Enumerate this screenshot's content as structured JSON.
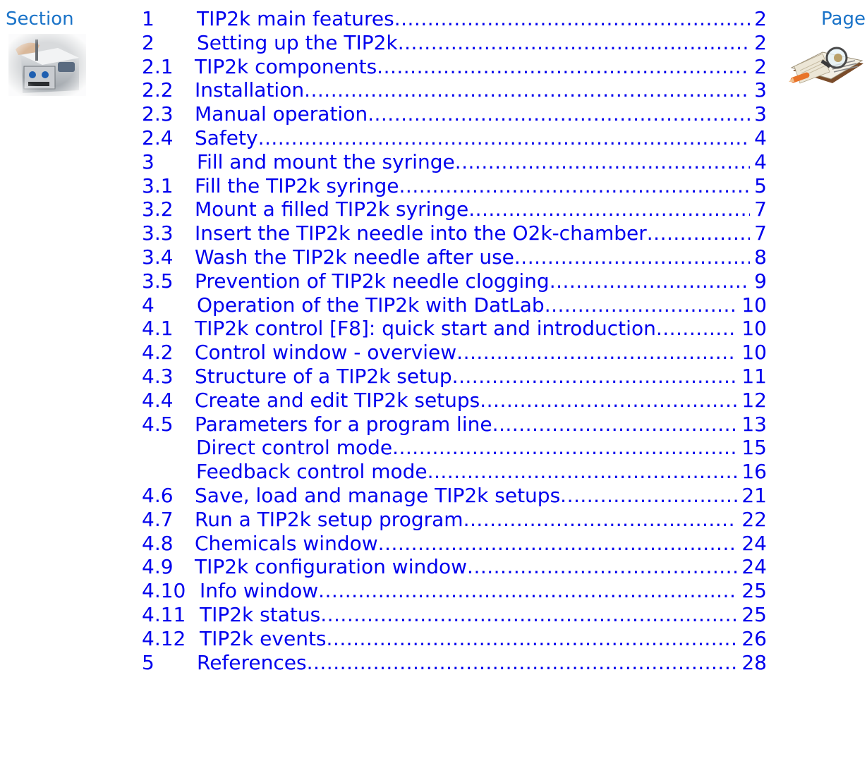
{
  "header": {
    "section_label": "Section",
    "page_label": "Page"
  },
  "icons": {
    "device": "tip2k-device-photo",
    "book": "book-magnifier-icon"
  },
  "toc": [
    {
      "num": "1",
      "title": "TIP2k main features",
      "page": "2"
    },
    {
      "num": "2",
      "title": "Setting up the TIP2k",
      "page": "2"
    },
    {
      "num": "2.1",
      "title": "TIP2k components",
      "page": "2"
    },
    {
      "num": "2.2",
      "title": "Installation",
      "page": "3"
    },
    {
      "num": "2.3",
      "title": "Manual operation",
      "page": "3"
    },
    {
      "num": "2.4",
      "title": "Safety",
      "page": "4"
    },
    {
      "num": "3",
      "title": "Fill and mount the syringe",
      "page": "4"
    },
    {
      "num": "3.1",
      "title": "Fill the TIP2k syringe",
      "page": "5"
    },
    {
      "num": "3.2",
      "title": "Mount a filled TIP2k syringe",
      "page": "7"
    },
    {
      "num": "3.3",
      "title": "Insert the TIP2k needle into the O2k-chamber",
      "page": "7"
    },
    {
      "num": "3.4",
      "title": "Wash the TIP2k needle after use",
      "page": "8"
    },
    {
      "num": "3.5",
      "title": "Prevention of TIP2k needle clogging",
      "page": "9"
    },
    {
      "num": "4",
      "title": "Operation of the TIP2k with DatLab",
      "page": "10"
    },
    {
      "num": "4.1",
      "title": "TIP2k control  [F8]: quick start and introduction",
      "page": "10"
    },
    {
      "num": "4.2",
      "title": "Control window - overview",
      "page": "10"
    },
    {
      "num": "4.3",
      "title": "Structure of a TIP2k setup",
      "page": "11"
    },
    {
      "num": "4.4",
      "title": "Create and edit TIP2k setups",
      "page": "12"
    },
    {
      "num": "4.5",
      "title": "Parameters for a program line",
      "page": "13"
    },
    {
      "num": "",
      "title": "Direct control mode",
      "page": "15",
      "indent": true
    },
    {
      "num": "",
      "title": "Feedback control mode",
      "page": "16",
      "indent": true
    },
    {
      "num": "4.6",
      "title": "Save, load and manage TIP2k setups",
      "page": "21"
    },
    {
      "num": "4.7",
      "title": "Run a TIP2k setup program",
      "page": "22"
    },
    {
      "num": "4.8",
      "title": "Chemicals window",
      "page": "24"
    },
    {
      "num": "4.9",
      "title": "TIP2k configuration window",
      "page": "24"
    },
    {
      "num": "4.10",
      "title": "Info window",
      "page": "25"
    },
    {
      "num": "4.11",
      "title": "TIP2k status",
      "page": "25"
    },
    {
      "num": "4.12",
      "title": "TIP2k events",
      "page": "26"
    },
    {
      "num": "5",
      "title": "References",
      "page": "28"
    }
  ]
}
